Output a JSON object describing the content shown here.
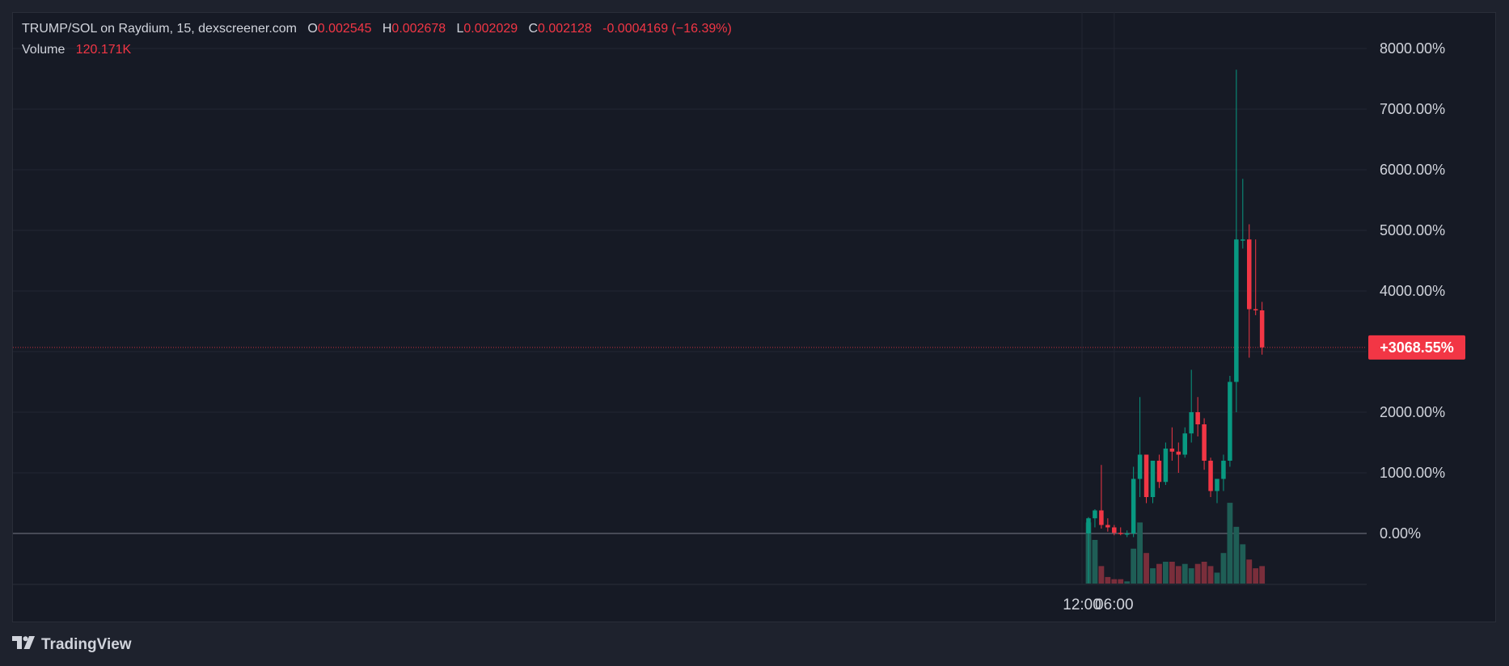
{
  "legend": {
    "title": "TRUMP/SOL on Raydium, 15, dexscreener.com",
    "o_label": "O",
    "o_value": "0.002545",
    "h_label": "H",
    "h_value": "0.002678",
    "l_label": "L",
    "l_value": "0.002029",
    "c_label": "C",
    "c_value": "0.002128",
    "change": "-0.0004169 (−16.39%)",
    "volume_label": "Volume",
    "volume_value": "120.171K"
  },
  "last_value_badge": "+3068.55%",
  "brand": {
    "name": "TradingView",
    "icon": "tradingview-logo-icon"
  },
  "colors": {
    "background": "#161a25",
    "grid": "#232733",
    "up": "#089981",
    "down": "#f23645",
    "up_volume": "#1f5e56",
    "down_volume": "#7a2e3b",
    "axis_text": "#d1d4dc"
  },
  "chart_data": {
    "type": "candlestick",
    "y_unit": "%",
    "ylim": [
      -800,
      8000
    ],
    "y_ticks": [
      {
        "value": 8000,
        "label": "8000.00%"
      },
      {
        "value": 7000,
        "label": "7000.00%"
      },
      {
        "value": 6000,
        "label": "6000.00%"
      },
      {
        "value": 5000,
        "label": "5000.00%"
      },
      {
        "value": 4000,
        "label": "4000.00%"
      },
      {
        "value": 2000,
        "label": "2000.00%"
      },
      {
        "value": 1000,
        "label": "1000.00%"
      },
      {
        "value": 0,
        "label": "0.00%"
      }
    ],
    "x_ticks": [
      {
        "time": "06:00",
        "label": "06:00"
      },
      {
        "time": "12:00",
        "label": "12:00"
      }
    ],
    "last_value": 3068.55,
    "grid": true,
    "candles": [
      {
        "time": "05:00",
        "o": 0,
        "h": 270,
        "l": -820,
        "c": 250
      },
      {
        "time": "05:15",
        "o": 250,
        "h": 400,
        "l": 100,
        "c": 380
      },
      {
        "time": "05:30",
        "o": 380,
        "h": 1130,
        "l": 80,
        "c": 140
      },
      {
        "time": "05:45",
        "o": 140,
        "h": 250,
        "l": 30,
        "c": 100
      },
      {
        "time": "06:00",
        "o": 100,
        "h": 140,
        "l": -30,
        "c": 10
      },
      {
        "time": "06:15",
        "o": 10,
        "h": 100,
        "l": -30,
        "c": -10
      },
      {
        "time": "06:30",
        "o": -10,
        "h": 50,
        "l": -60,
        "c": 0
      },
      {
        "time": "06:45",
        "o": 0,
        "h": 1100,
        "l": -60,
        "c": 900
      },
      {
        "time": "07:00",
        "o": 900,
        "h": 2250,
        "l": 600,
        "c": 1300
      },
      {
        "time": "07:15",
        "o": 1300,
        "h": 1300,
        "l": 500,
        "c": 600
      },
      {
        "time": "07:30",
        "o": 600,
        "h": 1200,
        "l": 500,
        "c": 1200
      },
      {
        "time": "07:45",
        "o": 1200,
        "h": 1300,
        "l": 750,
        "c": 850
      },
      {
        "time": "08:00",
        "o": 850,
        "h": 1500,
        "l": 800,
        "c": 1400
      },
      {
        "time": "08:15",
        "o": 1400,
        "h": 1750,
        "l": 1200,
        "c": 1350
      },
      {
        "time": "08:30",
        "o": 1350,
        "h": 1500,
        "l": 1000,
        "c": 1300
      },
      {
        "time": "08:45",
        "o": 1300,
        "h": 1750,
        "l": 1250,
        "c": 1650
      },
      {
        "time": "09:00",
        "o": 1650,
        "h": 2700,
        "l": 1500,
        "c": 2000
      },
      {
        "time": "09:15",
        "o": 2000,
        "h": 2250,
        "l": 1600,
        "c": 1800
      },
      {
        "time": "09:30",
        "o": 1800,
        "h": 1900,
        "l": 1050,
        "c": 1200
      },
      {
        "time": "09:45",
        "o": 1200,
        "h": 1250,
        "l": 600,
        "c": 700
      },
      {
        "time": "10:00",
        "o": 700,
        "h": 900,
        "l": 500,
        "c": 900
      },
      {
        "time": "10:15",
        "o": 900,
        "h": 1300,
        "l": 700,
        "c": 1200
      },
      {
        "time": "10:30",
        "o": 1200,
        "h": 2600,
        "l": 1100,
        "c": 2500
      },
      {
        "time": "10:45",
        "o": 2500,
        "h": 7650,
        "l": 2000,
        "c": 4850
      },
      {
        "time": "11:00",
        "o": 4850,
        "h": 5850,
        "l": 4700,
        "c": 4850
      },
      {
        "time": "11:15",
        "o": 4850,
        "h": 5100,
        "l": 2900,
        "c": 3700
      },
      {
        "time": "11:30",
        "o": 3700,
        "h": 4850,
        "l": 3600,
        "c": 3680
      },
      {
        "time": "11:45",
        "o": 3680,
        "h": 3820,
        "l": 2950,
        "c": 3070
      }
    ],
    "volume": [
      28,
      20,
      8,
      3,
      2,
      2,
      1,
      16,
      28,
      14,
      7,
      9,
      10,
      10,
      8,
      9,
      7,
      9,
      10,
      8,
      5,
      14,
      37,
      26,
      18,
      11,
      7,
      8
    ]
  }
}
